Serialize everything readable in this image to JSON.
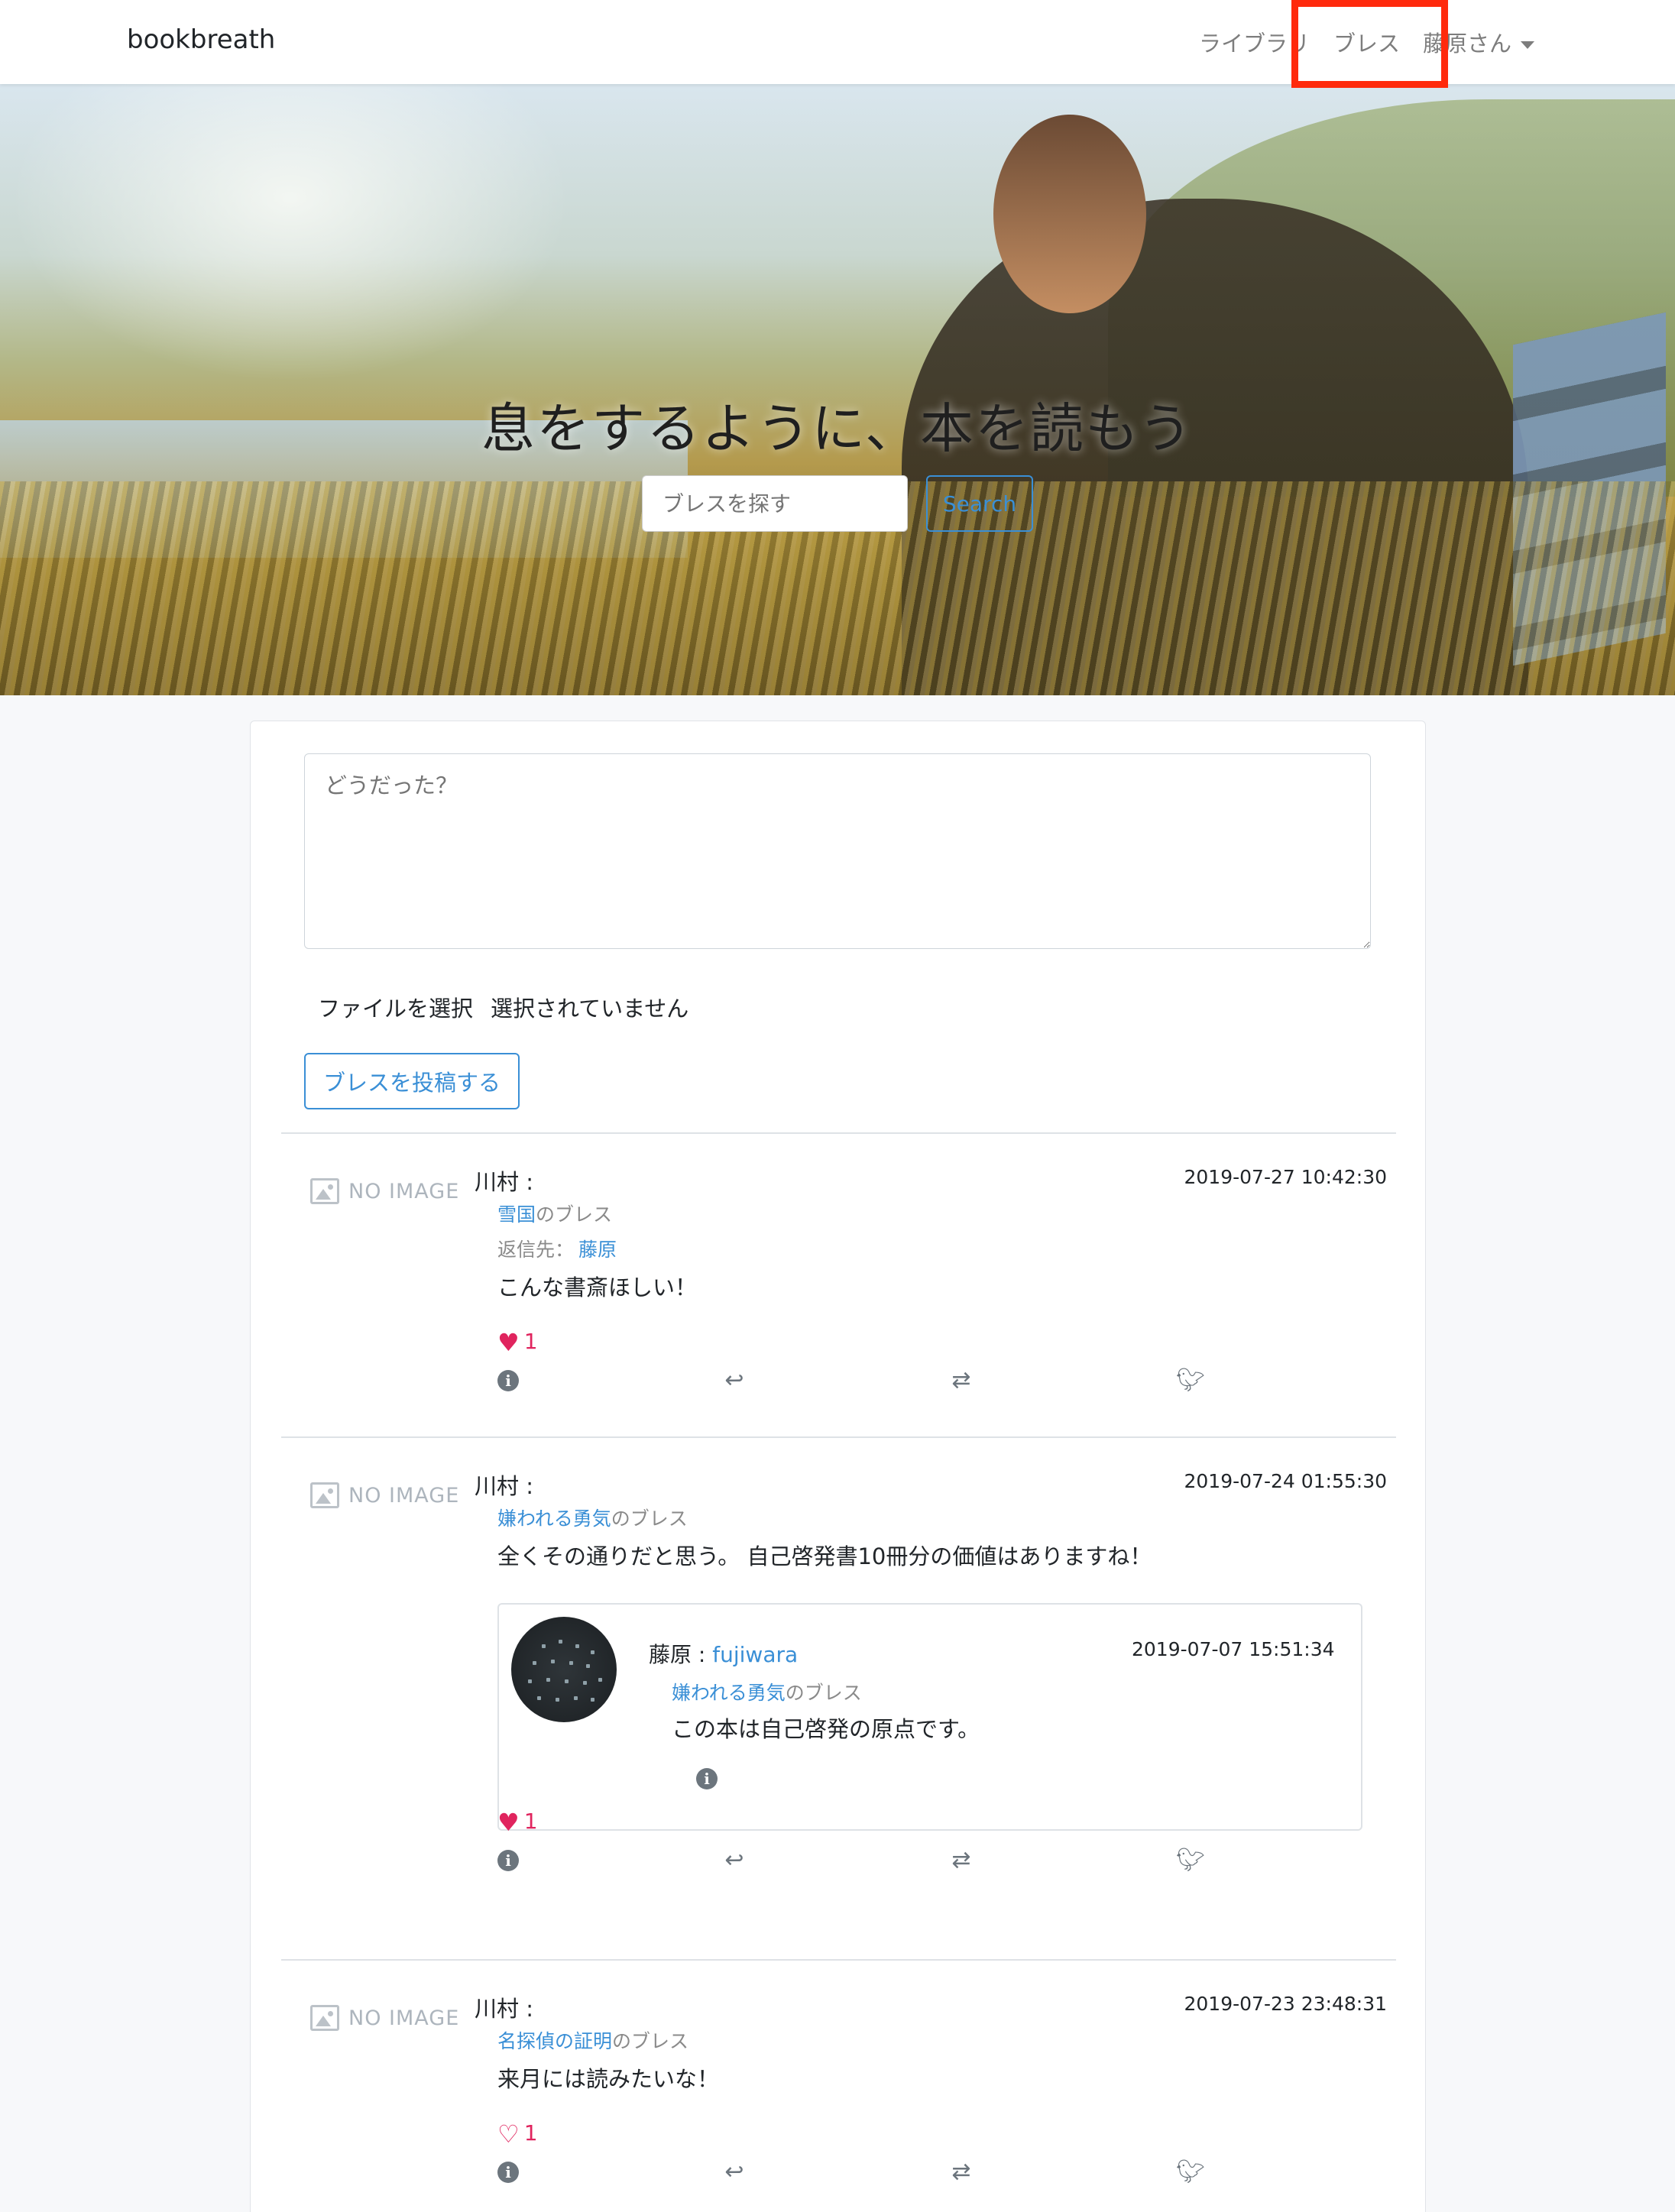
{
  "navbar": {
    "brand": "bookbreath",
    "library": "ライブラリ",
    "breath": "ブレス",
    "user": "藤原さん"
  },
  "hero": {
    "title": "息をするように、本を読もう",
    "search_placeholder": "ブレスを探す",
    "search_button": "Search"
  },
  "compose": {
    "placeholder": "どうだった？",
    "file_button": "ファイルを選択",
    "file_status": "選択されていません",
    "post_button": "ブレスを投稿する"
  },
  "posts": [
    {
      "image_label": "NO IMAGE",
      "author": "川村 :",
      "date": "2019-07-27 10:42:30",
      "book": "雪国",
      "book_suffix": "のブレス",
      "reply_label": "返信先：",
      "reply_to": "藤原",
      "body": "こんな書斎ほしい！",
      "likes": "1",
      "liked": true
    },
    {
      "image_label": "NO IMAGE",
      "author": "川村 :",
      "date": "2019-07-24 01:55:30",
      "book": "嫌われる勇気",
      "book_suffix": "のブレス",
      "body": "全くその通りだと思う。 自己啓発書10冊分の価値はありますね！",
      "likes": "1",
      "liked": true,
      "quote": {
        "author": "藤原 : ",
        "handle": "fujiwara",
        "date": "2019-07-07 15:51:34",
        "book": "嫌われる勇気",
        "book_suffix": "のブレス",
        "body": "この本は自己啓発の原点です。"
      }
    },
    {
      "image_label": "NO IMAGE",
      "author": "川村 :",
      "date": "2019-07-23 23:48:31",
      "book": "名探偵の証明",
      "book_suffix": "のブレス",
      "body": "来月には読みたいな！",
      "likes": "1",
      "liked": false
    }
  ],
  "icons": {
    "info": "info-circle-icon",
    "reply": "reply-icon",
    "retweet": "retweet-icon",
    "twitter": "twitter-icon",
    "heart": "heart-icon",
    "no_image": "image-placeholder-icon"
  },
  "colors": {
    "accent": "#3a8fd6",
    "like": "#e0245e",
    "highlight": "#ff2a0c"
  }
}
